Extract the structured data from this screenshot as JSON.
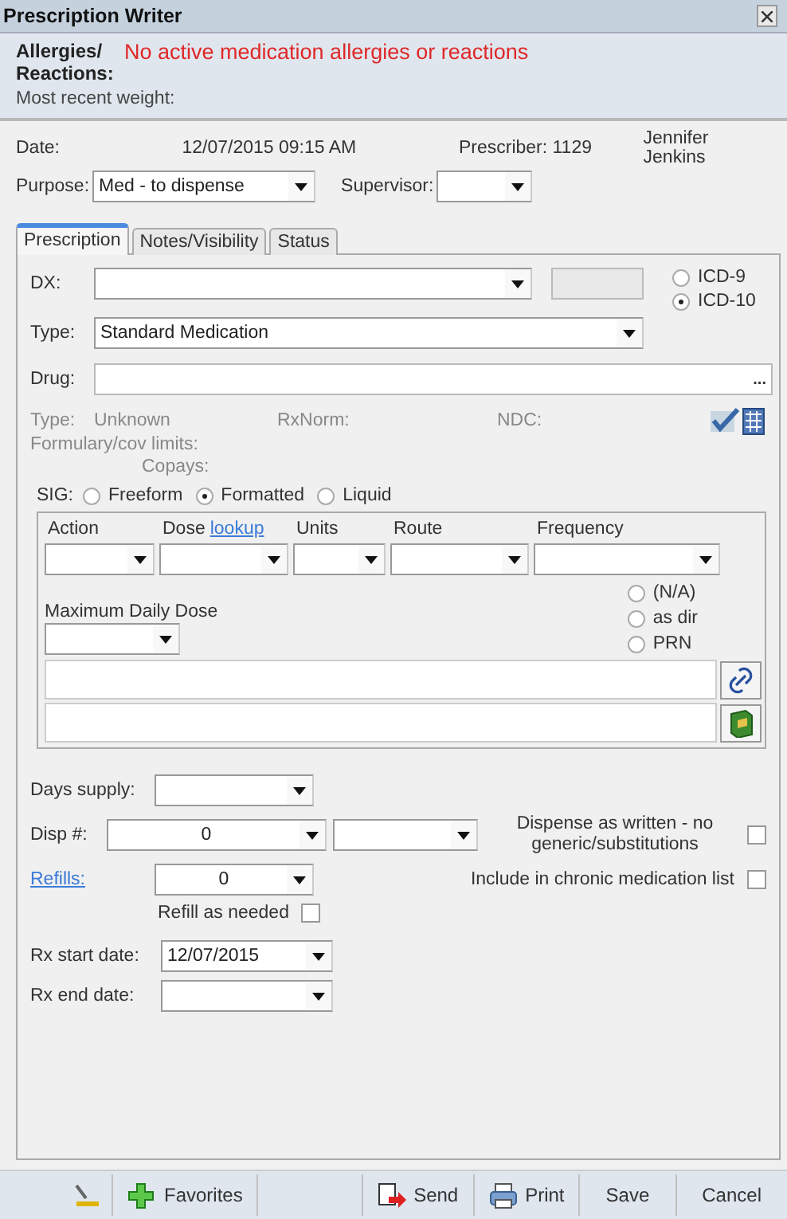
{
  "window": {
    "title": "Prescription Writer"
  },
  "header": {
    "allergies_label": "Allergies/ Reactions:",
    "allergies_text": "No active medication allergies or reactions",
    "weight_label": "Most recent weight:"
  },
  "info": {
    "date_label": "Date:",
    "date": "12/07/2015 09:15 AM",
    "prescriber_label": "Prescriber: 1129",
    "prescriber_name": "Jennifer Jenkins",
    "purpose_label": "Purpose:",
    "purpose": "Med - to dispense",
    "supervisor_label": "Supervisor:"
  },
  "tabs": [
    {
      "label": "Prescription",
      "selected": true
    },
    {
      "label": "Notes/Visibility",
      "selected": false
    },
    {
      "label": "Status",
      "selected": false
    }
  ],
  "dx": {
    "label": "DX:",
    "code_systems": [
      {
        "label": "ICD-9",
        "selected": false
      },
      {
        "label": "ICD-10",
        "selected": true
      }
    ]
  },
  "type": {
    "label": "Type:",
    "value": "Standard Medication"
  },
  "drug": {
    "label": "Drug:",
    "browse": "..."
  },
  "drug_info": {
    "type_label": "Type:",
    "type_value": "Unknown",
    "rxnorm_label": "RxNorm:",
    "ndc_label": "NDC:",
    "formulary_label": "Formulary/cov limits:",
    "copays_label": "Copays:"
  },
  "sig": {
    "label": "SIG:",
    "modes": [
      {
        "label": "Freeform",
        "selected": false
      },
      {
        "label": "Formatted",
        "selected": true
      },
      {
        "label": "Liquid",
        "selected": false
      }
    ],
    "columns": [
      {
        "label": "Action"
      },
      {
        "label": "Dose",
        "link": "lookup"
      },
      {
        "label": "Units"
      },
      {
        "label": "Route"
      },
      {
        "label": "Frequency"
      }
    ],
    "max_dose_label": "Maximum Daily Dose",
    "options": [
      {
        "label": "(N/A)",
        "selected": false
      },
      {
        "label": "as dir",
        "selected": false
      },
      {
        "label": "PRN",
        "selected": false
      }
    ]
  },
  "supply": {
    "days_label": "Days supply:",
    "disp_label": "Disp #:",
    "disp_value": "0",
    "refills_label": "Refills:",
    "refills_value": "0",
    "refill_as_needed": {
      "label": "Refill as needed",
      "checked": false
    },
    "daw": {
      "label": "Dispense as written - no generic/substitutions",
      "checked": false
    },
    "chronic": {
      "label": "Include in chronic medication list",
      "checked": false
    },
    "start_label": "Rx start date:",
    "start_value": "12/07/2015",
    "end_label": "Rx end date:"
  },
  "toolbar": [
    {
      "kind": "signature"
    },
    {
      "kind": "favorites",
      "label": "Favorites"
    },
    {
      "kind": "spacer"
    },
    {
      "kind": "send",
      "label": "Send"
    },
    {
      "kind": "print",
      "label": "Print"
    },
    {
      "kind": "text",
      "label": "Save"
    },
    {
      "kind": "text",
      "label": "Cancel"
    }
  ]
}
